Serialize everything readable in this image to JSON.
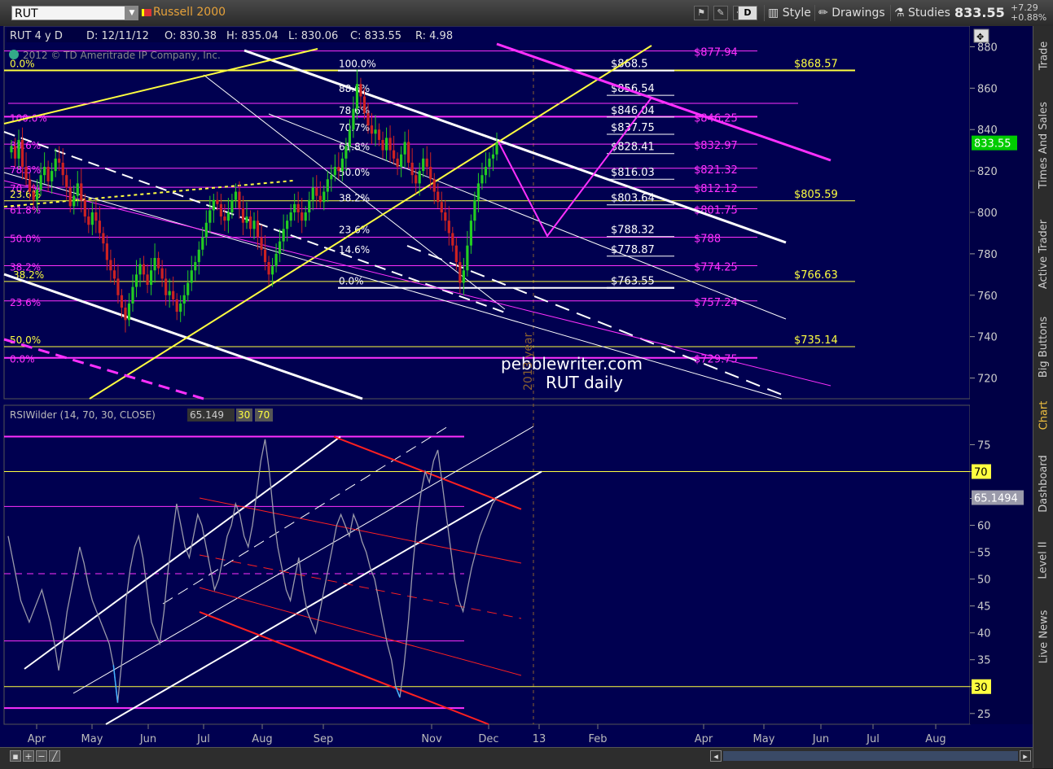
{
  "toolbar": {
    "symbol": "RUT",
    "symbol_name": "Russell 2000",
    "d_button": "D",
    "style_label": "Style",
    "drawings_label": "Drawings",
    "studies_label": "Studies",
    "last_price": "833.55",
    "change_abs": "+7.29",
    "change_pct": "+0.88%"
  },
  "chart_header": {
    "period": "RUT 4 y D",
    "date": "D: 12/11/12",
    "open": "O: 830.38",
    "high": "H: 835.04",
    "low": "L: 830.06",
    "close": "C: 833.55",
    "range": "R: 4.98",
    "copyright": "2012 © TD Ameritrade IP Company, Inc."
  },
  "sidebar_tabs": [
    "Trade",
    "Times And Sales",
    "Active Trader",
    "Big Buttons",
    "Chart",
    "Dashboard",
    "Level II",
    "Live News"
  ],
  "watermark": {
    "line1": "pebblewriter.com",
    "line2": "RUT daily",
    "year_marker": "2013 year"
  },
  "colors": {
    "background": "#000050",
    "magenta": "#ff30ff",
    "yellow": "#ffff40",
    "white": "#ffffff",
    "red": "#ff2020",
    "price_up": "#22cc22",
    "price_down": "#cc2222",
    "current_price_badge": "#00cc00"
  },
  "chart_data": [
    {
      "type": "candlestick",
      "title": "RUT 4 y D",
      "ylim": [
        710,
        890
      ],
      "x_labels": [
        "Apr",
        "May",
        "Jun",
        "Jul",
        "Aug",
        "Sep",
        "Nov",
        "Dec",
        "13",
        "Feb",
        "Apr",
        "May",
        "Jun",
        "Jul",
        "Aug"
      ],
      "y_ticks": [
        720,
        740,
        760,
        780,
        800,
        820,
        840,
        860,
        880
      ],
      "current_price": "833.55",
      "fib_white": [
        {
          "pct": "100.0%",
          "price": "$868.5"
        },
        {
          "pct": "88.6%",
          "price": "$856.54"
        },
        {
          "pct": "78.6%",
          "price": "$846.04"
        },
        {
          "pct": "70.7%",
          "price": "$837.75"
        },
        {
          "pct": "61.8%",
          "price": "$828.41"
        },
        {
          "pct": "50.0%",
          "price": "$816.03"
        },
        {
          "pct": "38.2%",
          "price": "$803.64"
        },
        {
          "pct": "23.6%",
          "price": "$788.32"
        },
        {
          "pct": "14.6%",
          "price": "$778.87"
        },
        {
          "pct": "0.0%",
          "price": "$763.55"
        }
      ],
      "fib_magenta_pcts": [
        "100.0%",
        "88.6%",
        "78.6%",
        "70.7%",
        "61.8%",
        "50.0%",
        "38.2%",
        "23.6%",
        "0.0%"
      ],
      "fib_magenta_prices": [
        "$877.94",
        "$846.25",
        "$832.97",
        "$821.32",
        "$812.12",
        "$801.75",
        "$788",
        "$774.25",
        "$757.24",
        "$729.75"
      ],
      "fib_yellow": [
        {
          "pct": "0.0%",
          "price": "$868.57"
        },
        {
          "pct": "23.6%",
          "price": "$805.59"
        },
        {
          "pct": "38.2%",
          "price": "$766.63"
        },
        {
          "pct": "50.0%",
          "price": "$735.14"
        }
      ],
      "closes": [
        832,
        826,
        835,
        822,
        816,
        810,
        806,
        811,
        818,
        822,
        815,
        820,
        826,
        824,
        818,
        812,
        803,
        808,
        814,
        806,
        798,
        794,
        800,
        796,
        790,
        785,
        777,
        772,
        768,
        760,
        754,
        748,
        756,
        764,
        770,
        775,
        770,
        765,
        772,
        778,
        773,
        768,
        760,
        762,
        758,
        752,
        756,
        760,
        766,
        772,
        776,
        782,
        788,
        795,
        801,
        806,
        804,
        798,
        796,
        800,
        806,
        810,
        802,
        795,
        798,
        792,
        796,
        788,
        782,
        776,
        770,
        774,
        780,
        786,
        792,
        796,
        800,
        804,
        800,
        796,
        800,
        806,
        812,
        808,
        805,
        810,
        816,
        818,
        822,
        820,
        826,
        832,
        840,
        850,
        862,
        856,
        848,
        842,
        838,
        840,
        835,
        830,
        836,
        830,
        826,
        822,
        828,
        834,
        824,
        818,
        814,
        820,
        826,
        822,
        816,
        810,
        805,
        800,
        796,
        790,
        784,
        776,
        766,
        772,
        784,
        796,
        806,
        814,
        818,
        822,
        826,
        828,
        833.55
      ]
    },
    {
      "type": "line",
      "title": "RSIWilder (14, 70, 30, CLOSE)",
      "study_value": "65.149",
      "overbought": "30",
      "oversold": "70",
      "ylim": [
        23,
        79
      ],
      "y_ticks": [
        25,
        30,
        35,
        40,
        45,
        50,
        55,
        60,
        65,
        70,
        75
      ],
      "marker_70": "70",
      "marker_30": "30",
      "current_value": "65.1494",
      "values": [
        58,
        54,
        50,
        46,
        44,
        42,
        44,
        46,
        48,
        45,
        42,
        38,
        33,
        38,
        44,
        48,
        52,
        56,
        53,
        49,
        46,
        44,
        42,
        40,
        38,
        34,
        27,
        35,
        46,
        52,
        56,
        58,
        54,
        48,
        42,
        40,
        38,
        44,
        52,
        58,
        64,
        60,
        56,
        54,
        58,
        62,
        60,
        56,
        52,
        48,
        50,
        54,
        58,
        60,
        64,
        62,
        58,
        56,
        60,
        66,
        72,
        76,
        70,
        62,
        56,
        52,
        48,
        46,
        50,
        54,
        48,
        44,
        42,
        40,
        44,
        48,
        52,
        56,
        60,
        62,
        60,
        58,
        62,
        60,
        57,
        55,
        52,
        50,
        46,
        42,
        38,
        35,
        30,
        28,
        34,
        42,
        52,
        60,
        66,
        70,
        68,
        72,
        74,
        68,
        62,
        56,
        50,
        46,
        44,
        48,
        52,
        55,
        58,
        60,
        62,
        64,
        65.149
      ]
    }
  ]
}
